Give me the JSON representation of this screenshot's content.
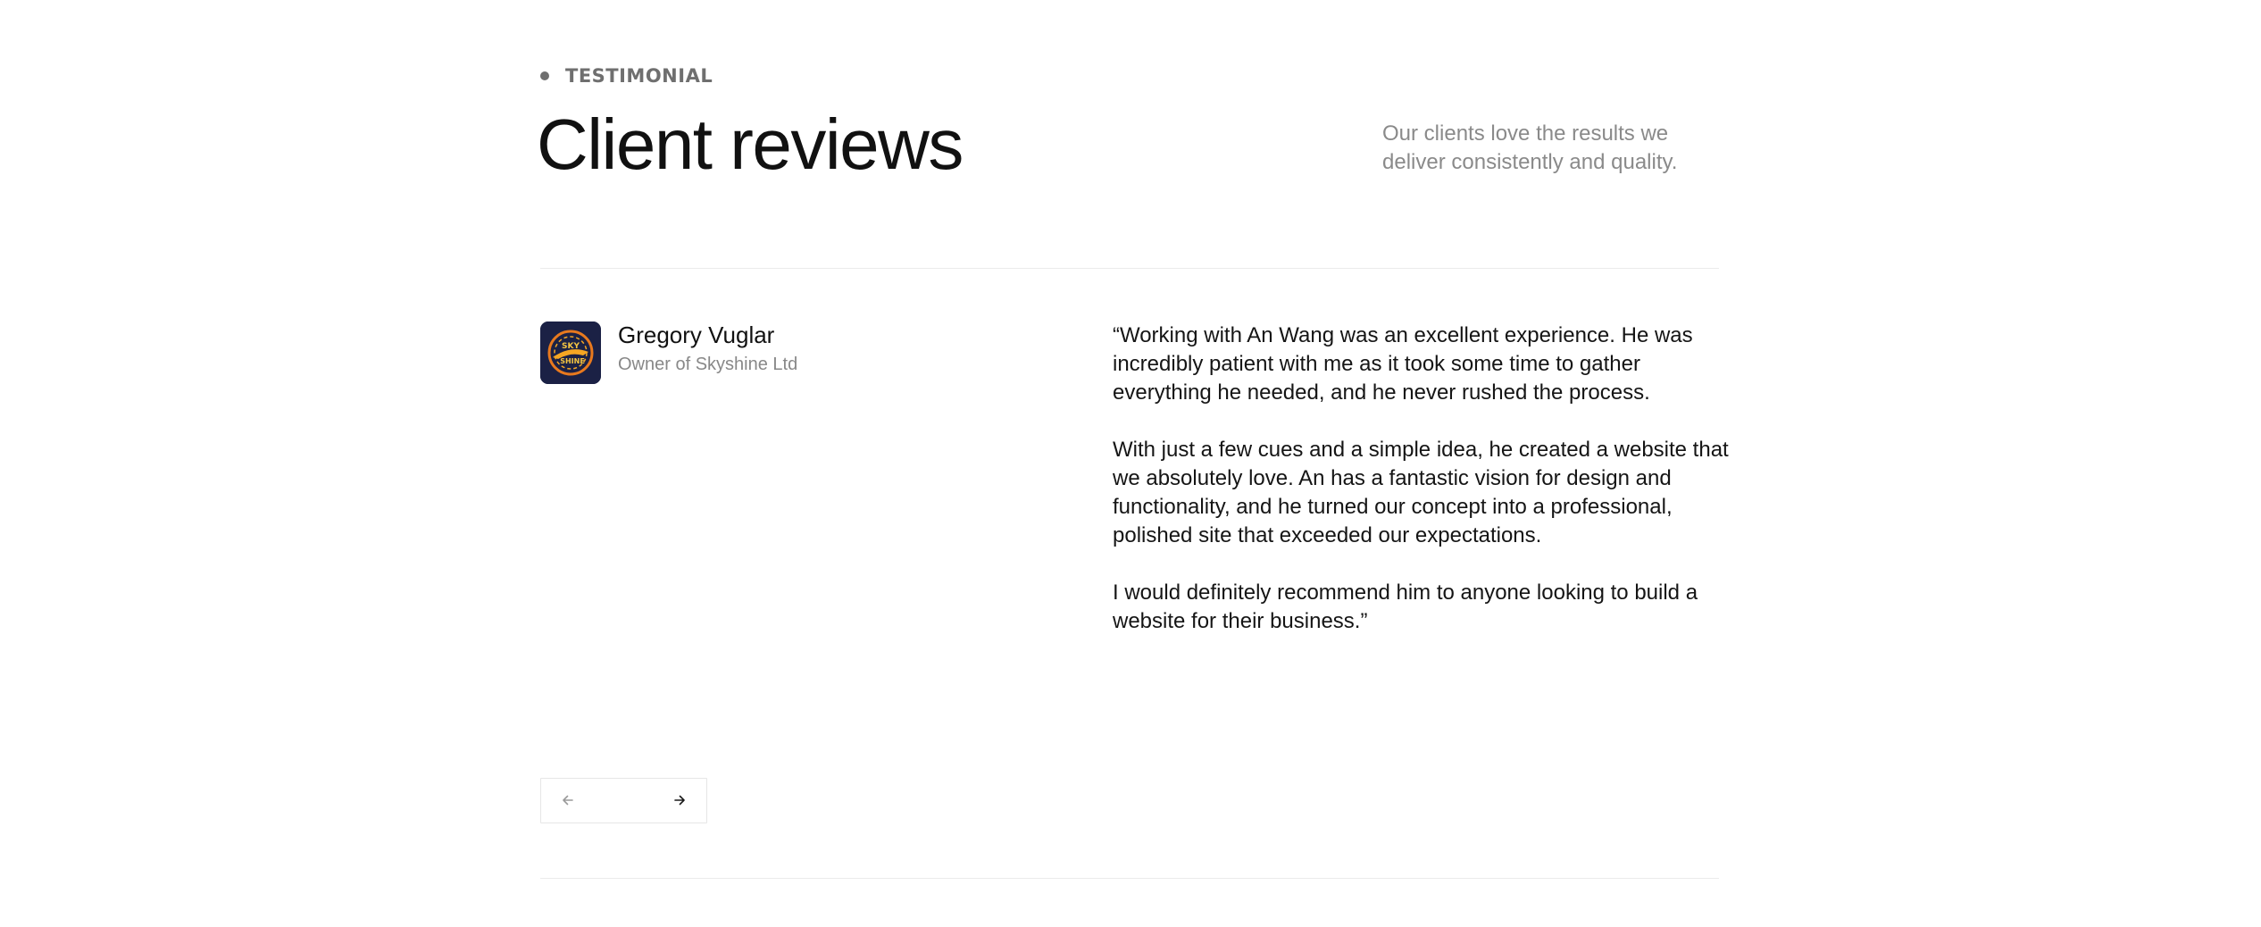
{
  "section": {
    "eyebrow": "TESTIMONIAL",
    "title": "Client reviews",
    "intro": "Our clients love the results we deliver consistently and quality."
  },
  "review": {
    "name": "Gregory Vuglar",
    "role": "Owner of Skyshine Ltd",
    "avatar_logo_text": "SKY SHINE",
    "paragraphs": [
      "“Working with An Wang was an excellent experience. He was incredibly patient with me as it took some time to gather everything he needed, and he never rushed the process.",
      "With just a few cues and a simple idea, he created a website that we absolutely love. An has a fantastic vision for design and functionality, and he turned our concept into a professional, polished site that exceeded our expectations.",
      "I would definitely recommend him to anyone looking to build a website for their business.”"
    ]
  },
  "nav": {
    "prev_icon": "arrow-left-icon",
    "next_icon": "arrow-right-icon"
  },
  "colors": {
    "muted_text": "#8a8a8a",
    "divider": "#ebebeb",
    "avatar_bg": "#1b2145",
    "avatar_accent": "#f5a623"
  }
}
